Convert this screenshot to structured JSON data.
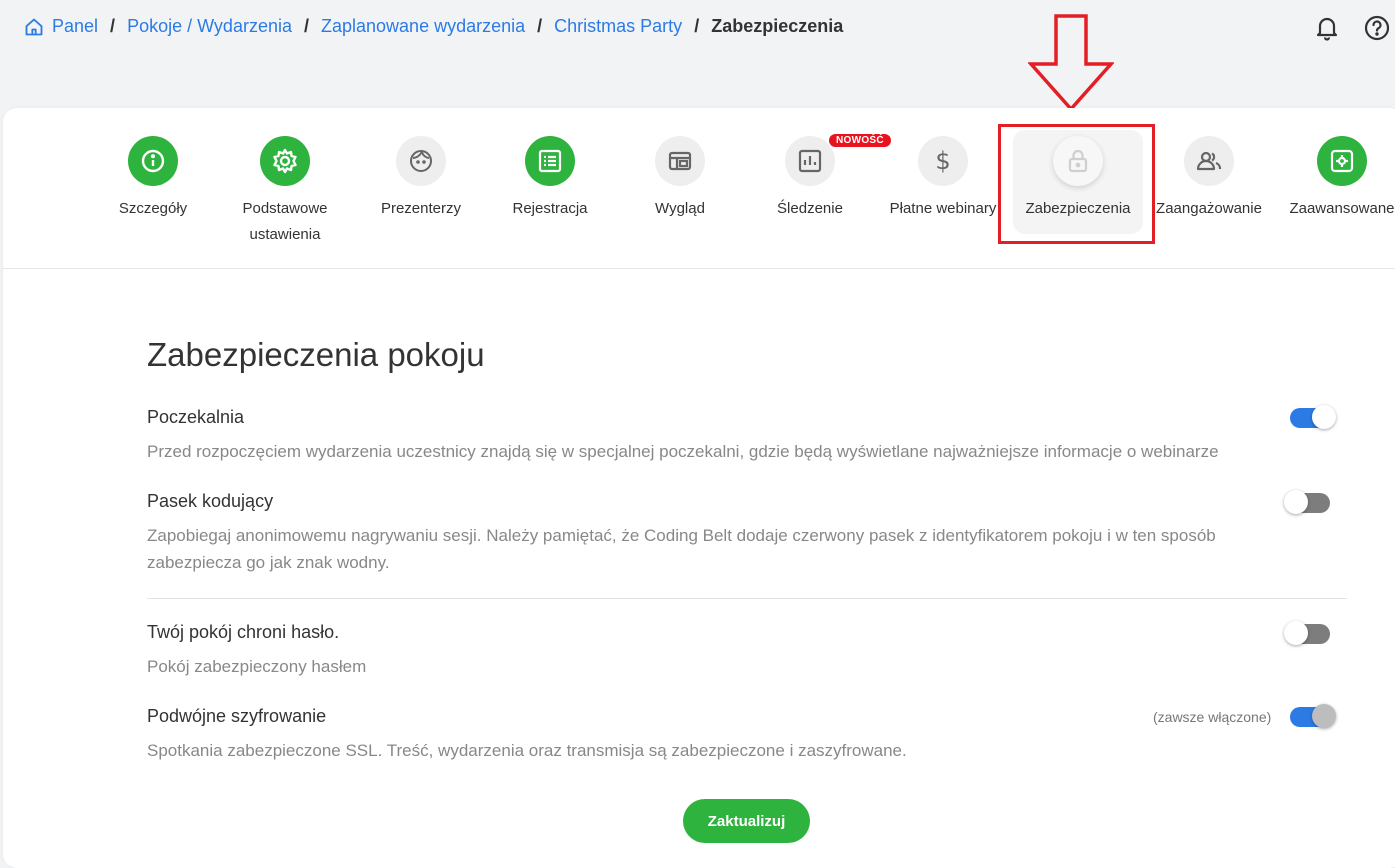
{
  "breadcrumb": {
    "items": [
      "Panel",
      "Pokoje / Wydarzenia",
      "Zaplanowane wydarzenia",
      "Christmas Party"
    ],
    "current": "Zabezpieczenia",
    "separator": "/"
  },
  "header_icons": [
    "bell-icon",
    "help-icon"
  ],
  "tabs": [
    {
      "label": "Szczegóły",
      "icon": "info-icon",
      "style": "green"
    },
    {
      "label": "Podstawowe ustawienia",
      "icon": "gear-icon",
      "style": "green"
    },
    {
      "label": "Prezenterzy",
      "icon": "face-icon",
      "style": "gray"
    },
    {
      "label": "Rejestracja",
      "icon": "form-icon",
      "style": "green"
    },
    {
      "label": "Wygląd",
      "icon": "layout-icon",
      "style": "gray"
    },
    {
      "label": "Śledzenie",
      "icon": "chart-icon",
      "style": "gray",
      "badge": "NOWOŚĆ"
    },
    {
      "label": "Płatne webinary",
      "icon": "dollar-icon",
      "style": "gray"
    },
    {
      "label": "Zabezpieczenia",
      "icon": "lock-icon",
      "style": "active"
    },
    {
      "label": "Zaangażowanie",
      "icon": "people-icon",
      "style": "gray"
    },
    {
      "label": "Zaawansowane",
      "icon": "settings-box-icon",
      "style": "green"
    }
  ],
  "section_title": "Zabezpieczenia pokoju",
  "settings": [
    {
      "title": "Poczekalnia",
      "description": "Przed rozpoczęciem wydarzenia uczestnicy znajdą się w specjalnej poczekalni, gdzie będą wyświetlane najważniejsze informacje o webinarze",
      "enabled": true
    },
    {
      "title": "Pasek kodujący",
      "description": "Zapobiegaj anonimowemu nagrywaniu sesji. Należy pamiętać, że Coding Belt dodaje czerwony pasek z identyfikatorem pokoju i w ten sposób zabezpiecza go jak znak wodny.",
      "enabled": false
    },
    {
      "title": "Twój pokój chroni hasło.",
      "description": "Pokój zabezpieczony hasłem",
      "enabled": false
    },
    {
      "title": "Podwójne szyfrowanie",
      "description": "Spotkania zabezpieczone SSL. Treść, wydarzenia oraz transmisja są zabezpieczone i zaszyfrowane.",
      "enabled": true,
      "note": "(zawsze włączone)"
    }
  ],
  "update_button": "Zaktualizuj",
  "colors": {
    "accent_blue": "#2c7be5",
    "green": "#2fb33f",
    "annotation_red": "#e31e24",
    "badge_red": "#e8131e"
  }
}
